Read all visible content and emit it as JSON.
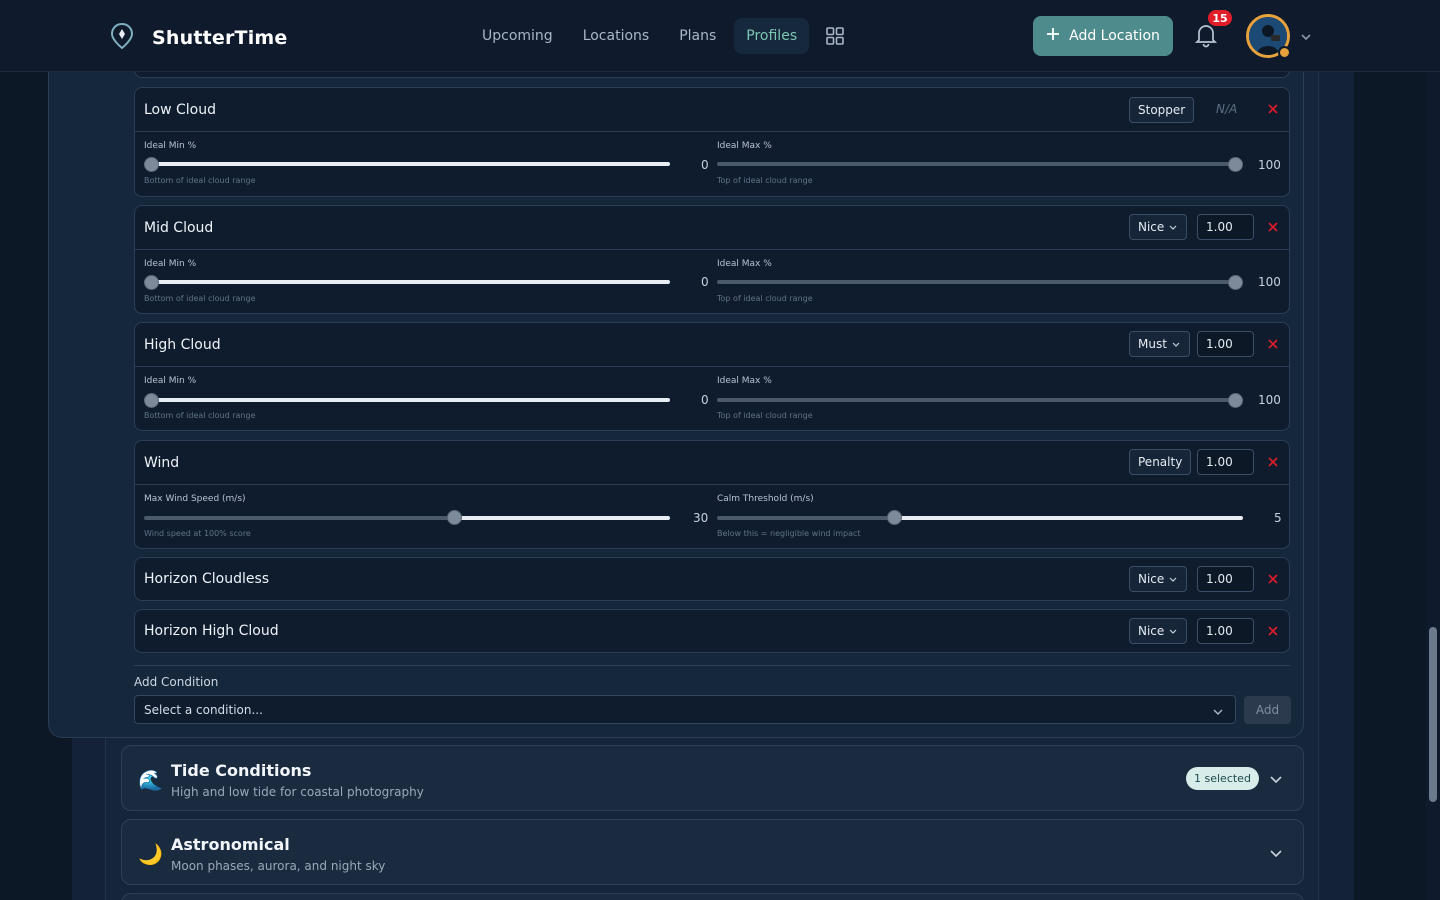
{
  "app": {
    "name": "ShutterTime"
  },
  "nav": {
    "items": [
      {
        "label": "Upcoming",
        "active": false
      },
      {
        "label": "Locations",
        "active": false
      },
      {
        "label": "Plans",
        "active": false
      },
      {
        "label": "Profiles",
        "active": true
      }
    ]
  },
  "header": {
    "add_location_label": "Add Location",
    "notification_count": "15"
  },
  "conditions": {
    "low_cloud": {
      "title": "Low Cloud",
      "mode": "Stopper",
      "weight": "N/A",
      "min": {
        "label": "Ideal Min %",
        "hint": "Bottom of ideal cloud range",
        "value": "0"
      },
      "max": {
        "label": "Ideal Max %",
        "hint": "Top of ideal cloud range",
        "value": "100"
      }
    },
    "mid_cloud": {
      "title": "Mid Cloud",
      "mode": "Nice",
      "weight": "1.00",
      "min": {
        "label": "Ideal Min %",
        "hint": "Bottom of ideal cloud range",
        "value": "0"
      },
      "max": {
        "label": "Ideal Max %",
        "hint": "Top of ideal cloud range",
        "value": "100"
      }
    },
    "high_cloud": {
      "title": "High Cloud",
      "mode": "Must",
      "weight": "1.00",
      "min": {
        "label": "Ideal Min %",
        "hint": "Bottom of ideal cloud range",
        "value": "0"
      },
      "max": {
        "label": "Ideal Max %",
        "hint": "Top of ideal cloud range",
        "value": "100"
      }
    },
    "wind": {
      "title": "Wind",
      "mode": "Penalty",
      "weight": "1.00",
      "max_speed": {
        "label": "Max Wind Speed (m/s)",
        "hint": "Wind speed at 100% score",
        "value": "30"
      },
      "calm": {
        "label": "Calm Threshold (m/s)",
        "hint": "Below this = negligible wind impact",
        "value": "5"
      }
    },
    "horizon_cloudless": {
      "title": "Horizon Cloudless",
      "mode": "Nice",
      "weight": "1.00"
    },
    "horizon_high_cloud": {
      "title": "Horizon High Cloud",
      "mode": "Nice",
      "weight": "1.00"
    }
  },
  "add_condition": {
    "label": "Add Condition",
    "placeholder": "Select a condition...",
    "button": "Add"
  },
  "sections": {
    "tide": {
      "icon": "🌊",
      "title": "Tide Conditions",
      "subtitle": "High and low tide for coastal photography",
      "badge": "1 selected"
    },
    "astro": {
      "icon": "🌙",
      "title": "Astronomical",
      "subtitle": "Moon phases, aurora, and night sky"
    }
  },
  "colors": {
    "accent": "#4e8b8c",
    "danger": "#e11d2a",
    "active_nav": "#7cc6b5"
  }
}
